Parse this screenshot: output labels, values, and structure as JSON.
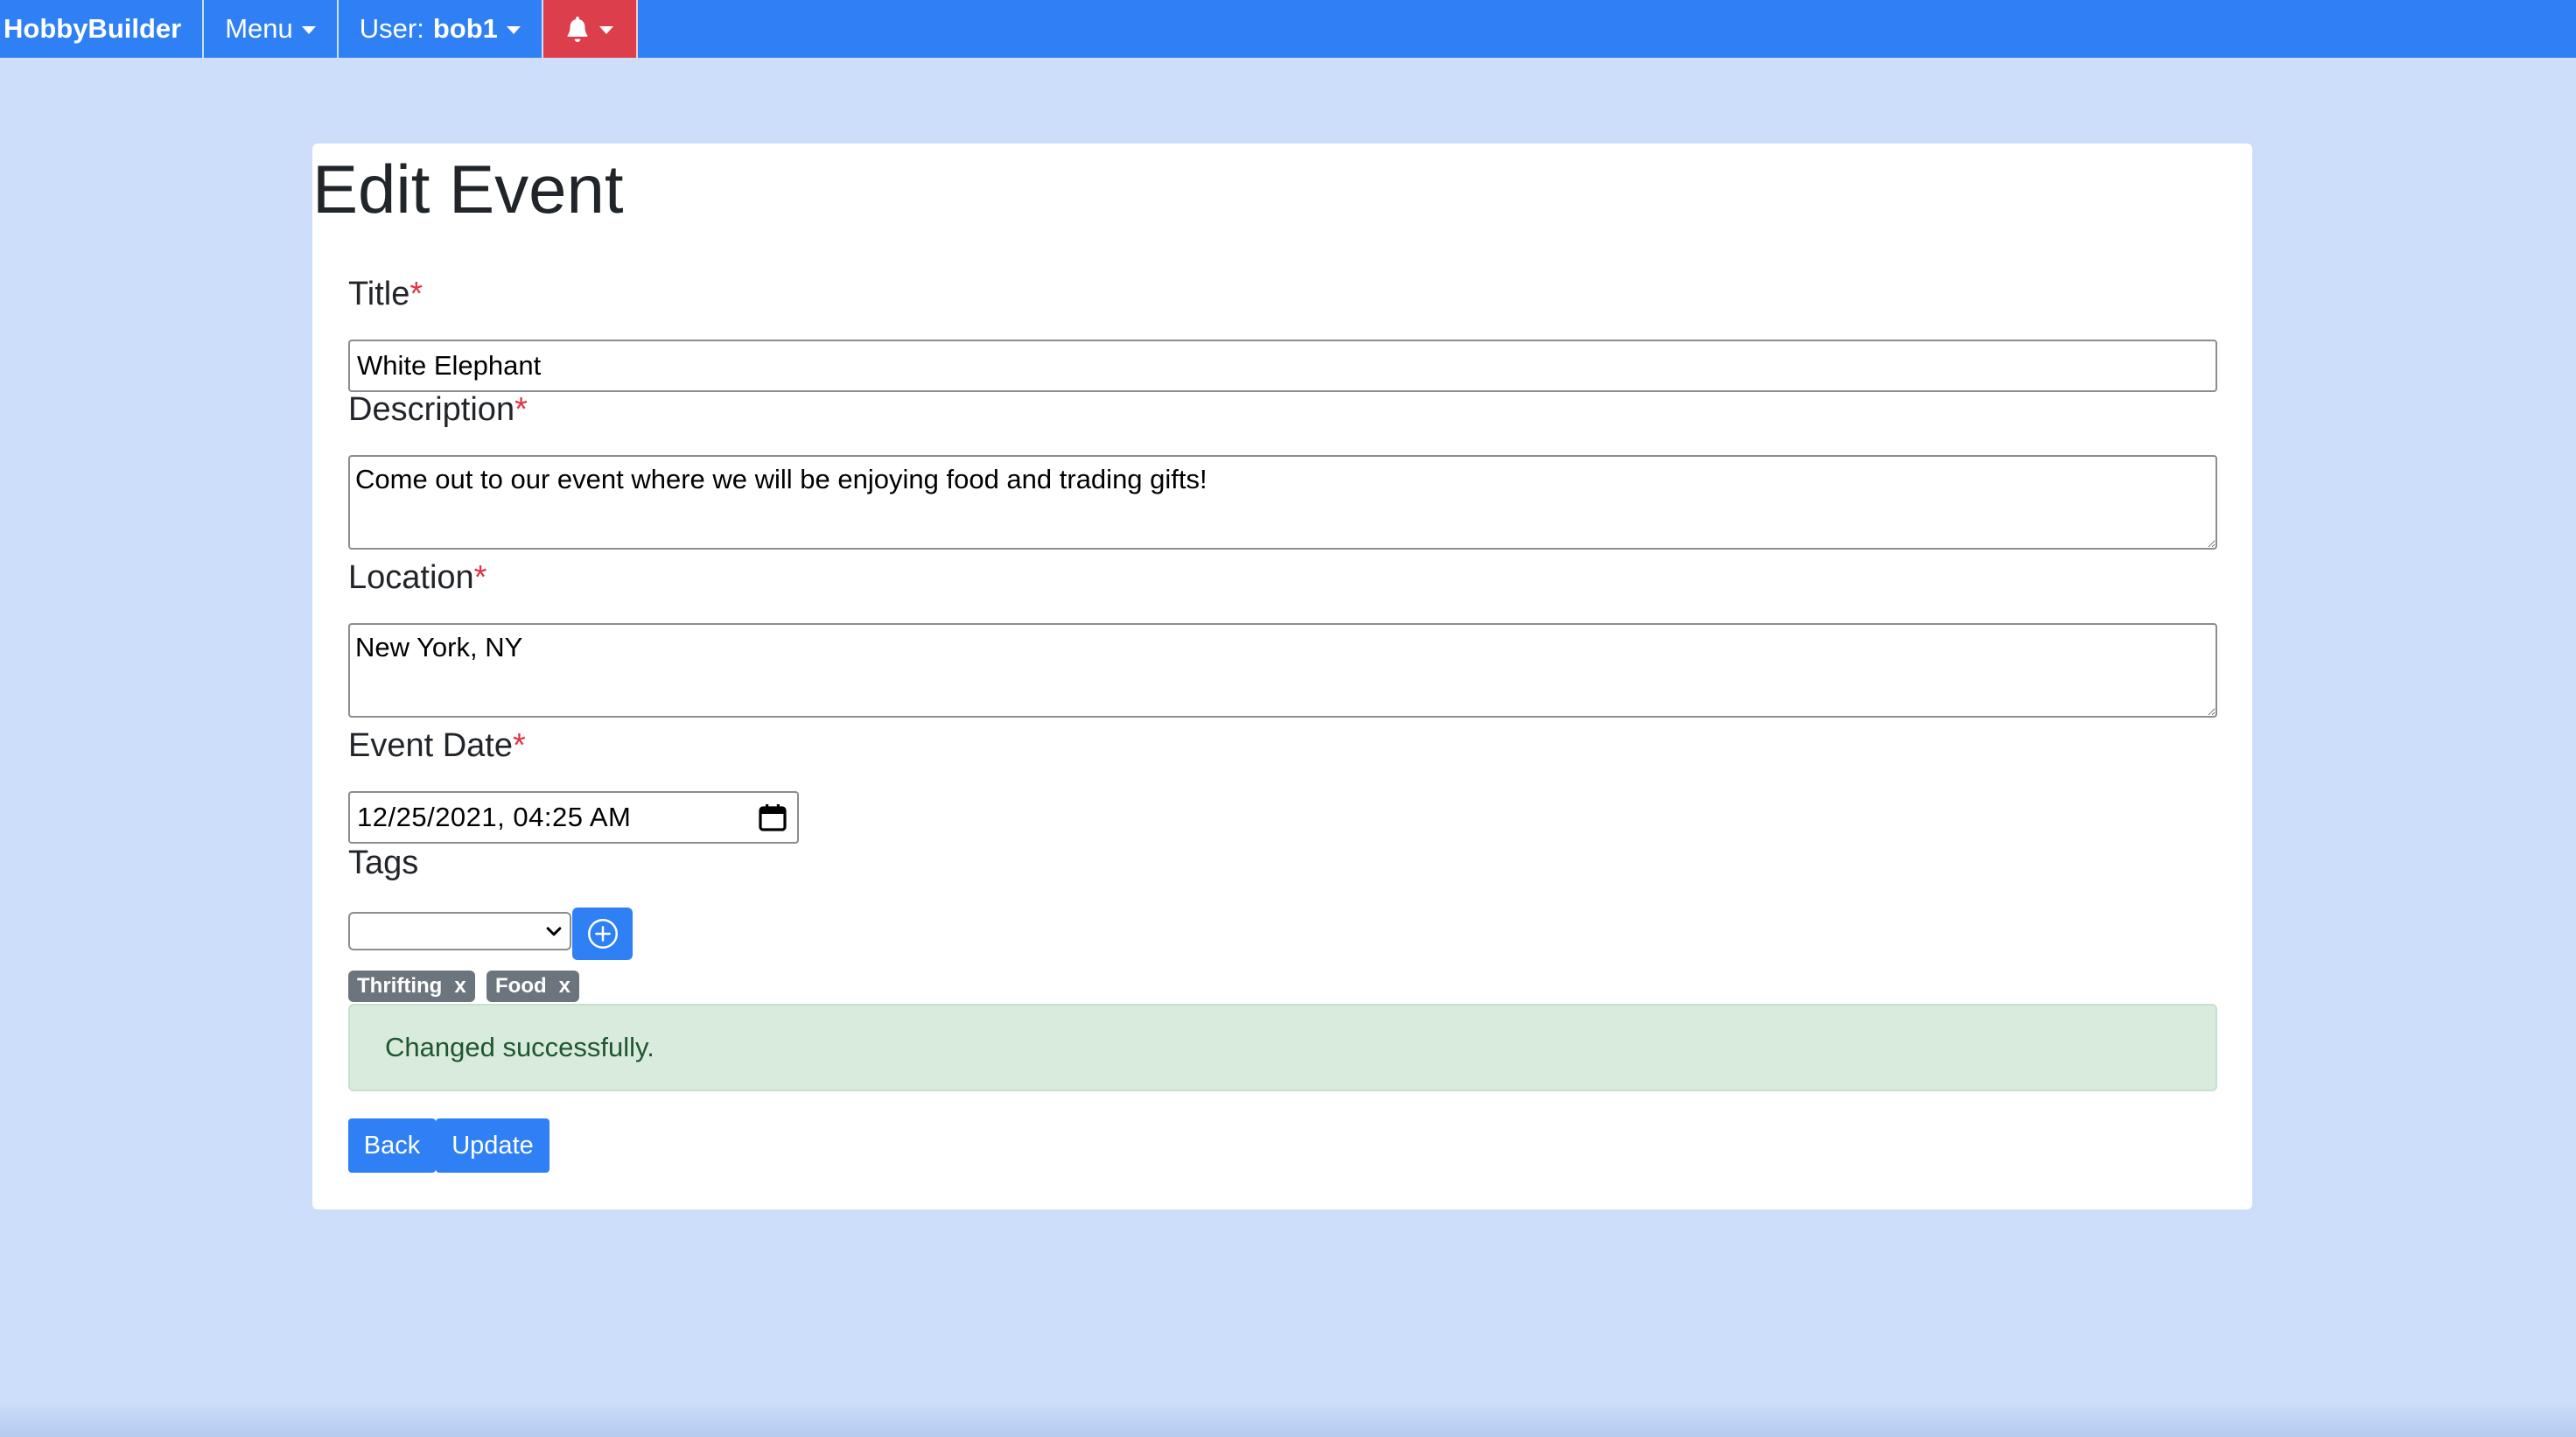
{
  "navbar": {
    "brand": "HobbyBuilder",
    "menu_label": "Menu",
    "user_prefix": "User:",
    "user_name": "bob1"
  },
  "page": {
    "title": "Edit Event"
  },
  "form": {
    "title_label": "Title",
    "title_value": "White Elephant",
    "description_label": "Description",
    "description_value": "Come out to our event where we will be enjoying food and trading gifts!",
    "location_label": "Location",
    "location_value": "New York, NY",
    "date_label": "Event Date",
    "date_value": "12/25/2021, 04:25 AM",
    "tags_label": "Tags",
    "tag_select_value": "",
    "required_marker": "*"
  },
  "tags": [
    {
      "label": "Thrifting",
      "remove": "x"
    },
    {
      "label": "Food",
      "remove": "x"
    }
  ],
  "alert": {
    "message": "Changed successfully."
  },
  "buttons": {
    "back": "Back",
    "update": "Update"
  },
  "colors": {
    "navbar": "#2f80f5",
    "notification": "#dc3f4b",
    "background": "#ccdefa",
    "primary": "#2f80f5",
    "tag": "#6c757d",
    "alert_bg": "#d9ebdd",
    "required": "#dc3545"
  },
  "icons": {
    "notification": "bell-icon",
    "calendar": "calendar-icon",
    "add": "plus-circle-icon",
    "select": "chevron-down-icon"
  }
}
